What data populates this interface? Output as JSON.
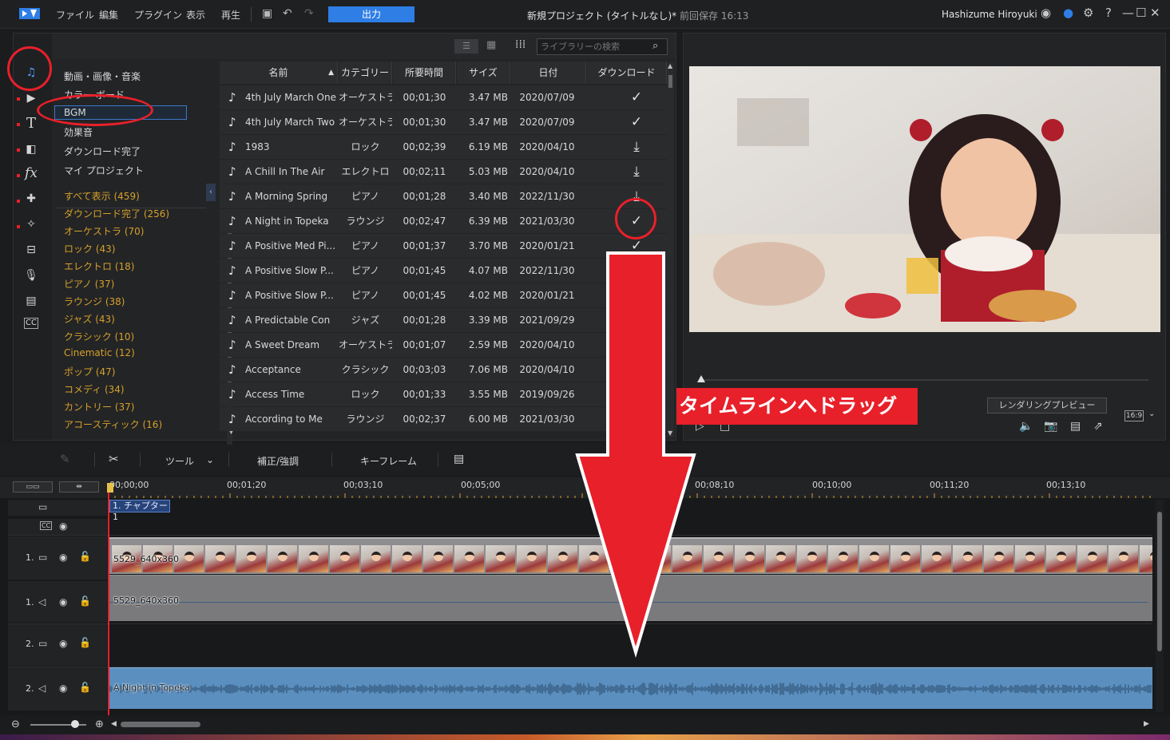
{
  "titlebar": {
    "menu": [
      "ファイル",
      "編集",
      "プラグイン",
      "表示",
      "再生"
    ],
    "output_label": "出力",
    "project_title": "新規プロジェクト (タイトルなし)*",
    "saved_text": "前回保存 16:13",
    "user_name": "Hashizume Hiroyuki"
  },
  "library": {
    "search_placeholder": "ライブラリーの検索",
    "categories": [
      "動画・画像・音楽",
      "カラー ボード",
      "BGM",
      "効果音",
      "ダウンロード完了",
      "マイ プロジェクト"
    ],
    "selected_category": "BGM",
    "genres": [
      "すべて表示 (459)",
      "ダウンロード完了 (256)",
      "オーケストラ (70)",
      "ロック (43)",
      "エレクトロ (18)",
      "ピアノ (37)",
      "ラウンジ (38)",
      "ジャズ (43)",
      "クラシック (10)",
      "Cinematic (12)",
      "ポップ (47)",
      "コメディ (34)",
      "カントリー (37)",
      "アコースティック (16)"
    ],
    "columns": [
      "名前",
      "カテゴリー",
      "所要時間",
      "サイズ",
      "日付",
      "ダウンロード"
    ],
    "rows": [
      {
        "name": "4th July March One",
        "category": "オーケストラ",
        "duration": "00;01;30",
        "size": "3.47 MB",
        "date": "2020/07/09",
        "download": "check"
      },
      {
        "name": "4th July March Two",
        "category": "オーケストラ",
        "duration": "00;01;30",
        "size": "3.47 MB",
        "date": "2020/07/09",
        "download": "check"
      },
      {
        "name": "1983",
        "category": "ロック",
        "duration": "00;02;39",
        "size": "6.19 MB",
        "date": "2020/04/10",
        "download": "download"
      },
      {
        "name": "A Chill In The Air",
        "category": "エレクトロ",
        "duration": "00;02;11",
        "size": "5.03 MB",
        "date": "2020/04/10",
        "download": "download"
      },
      {
        "name": "A Morning Spring",
        "category": "ピアノ",
        "duration": "00;01;28",
        "size": "3.40 MB",
        "date": "2022/11/30",
        "download": "download"
      },
      {
        "name": "A Night in Topeka",
        "category": "ラウンジ",
        "duration": "00;02;47",
        "size": "6.39 MB",
        "date": "2021/03/30",
        "download": "check"
      },
      {
        "name": "A Positive Med Pi...",
        "category": "ピアノ",
        "duration": "00;01;37",
        "size": "3.70 MB",
        "date": "2020/01/21",
        "download": "check"
      },
      {
        "name": "A Positive Slow P...",
        "category": "ピアノ",
        "duration": "00;01;45",
        "size": "4.07 MB",
        "date": "2022/11/30",
        "download": ""
      },
      {
        "name": "A Positive Slow P...",
        "category": "ピアノ",
        "duration": "00;01;45",
        "size": "4.02 MB",
        "date": "2020/01/21",
        "download": ""
      },
      {
        "name": "A Predictable Con",
        "category": "ジャズ",
        "duration": "00;01;28",
        "size": "3.39 MB",
        "date": "2021/09/29",
        "download": ""
      },
      {
        "name": "A Sweet Dream",
        "category": "オーケストラ",
        "duration": "00;01;07",
        "size": "2.59 MB",
        "date": "2020/04/10",
        "download": ""
      },
      {
        "name": "Acceptance",
        "category": "クラシック",
        "duration": "00;03;03",
        "size": "7.06 MB",
        "date": "2020/04/10",
        "download": ""
      },
      {
        "name": "Access Time",
        "category": "ロック",
        "duration": "00;01;33",
        "size": "3.55 MB",
        "date": "2019/09/26",
        "download": ""
      },
      {
        "name": "According to Me",
        "category": "ラウンジ",
        "duration": "00;02;37",
        "size": "6.00 MB",
        "date": "2021/03/30",
        "download": ""
      }
    ]
  },
  "preview": {
    "render_label": "レンダリングプレビュー",
    "aspect_ratio": "16:9"
  },
  "edit_toolbar": {
    "tools_label": "ツール",
    "correct_label": "補正/強調",
    "keyframe_label": "キーフレーム"
  },
  "ruler": {
    "labels": [
      "00;00;00",
      "00;01;20",
      "00;03;10",
      "00;05;00",
      "00;08;10",
      "00;10;00",
      "00;11;20",
      "00;13;10"
    ]
  },
  "timeline": {
    "chapter_label": "1. チャプター 1",
    "tracks": [
      {
        "number": "1.",
        "kind": "video"
      },
      {
        "number": "1.",
        "kind": "audio"
      },
      {
        "number": "2.",
        "kind": "video"
      },
      {
        "number": "2.",
        "kind": "audio"
      }
    ],
    "video_clip_label": "5529_640x360",
    "video_audio_clip_label": "5529_640x360",
    "bgm_clip_label": "A Night in Topeka"
  },
  "annotation": {
    "drag_text": "タイムラインへドラッグ",
    "accent_color": "#e8202a"
  }
}
